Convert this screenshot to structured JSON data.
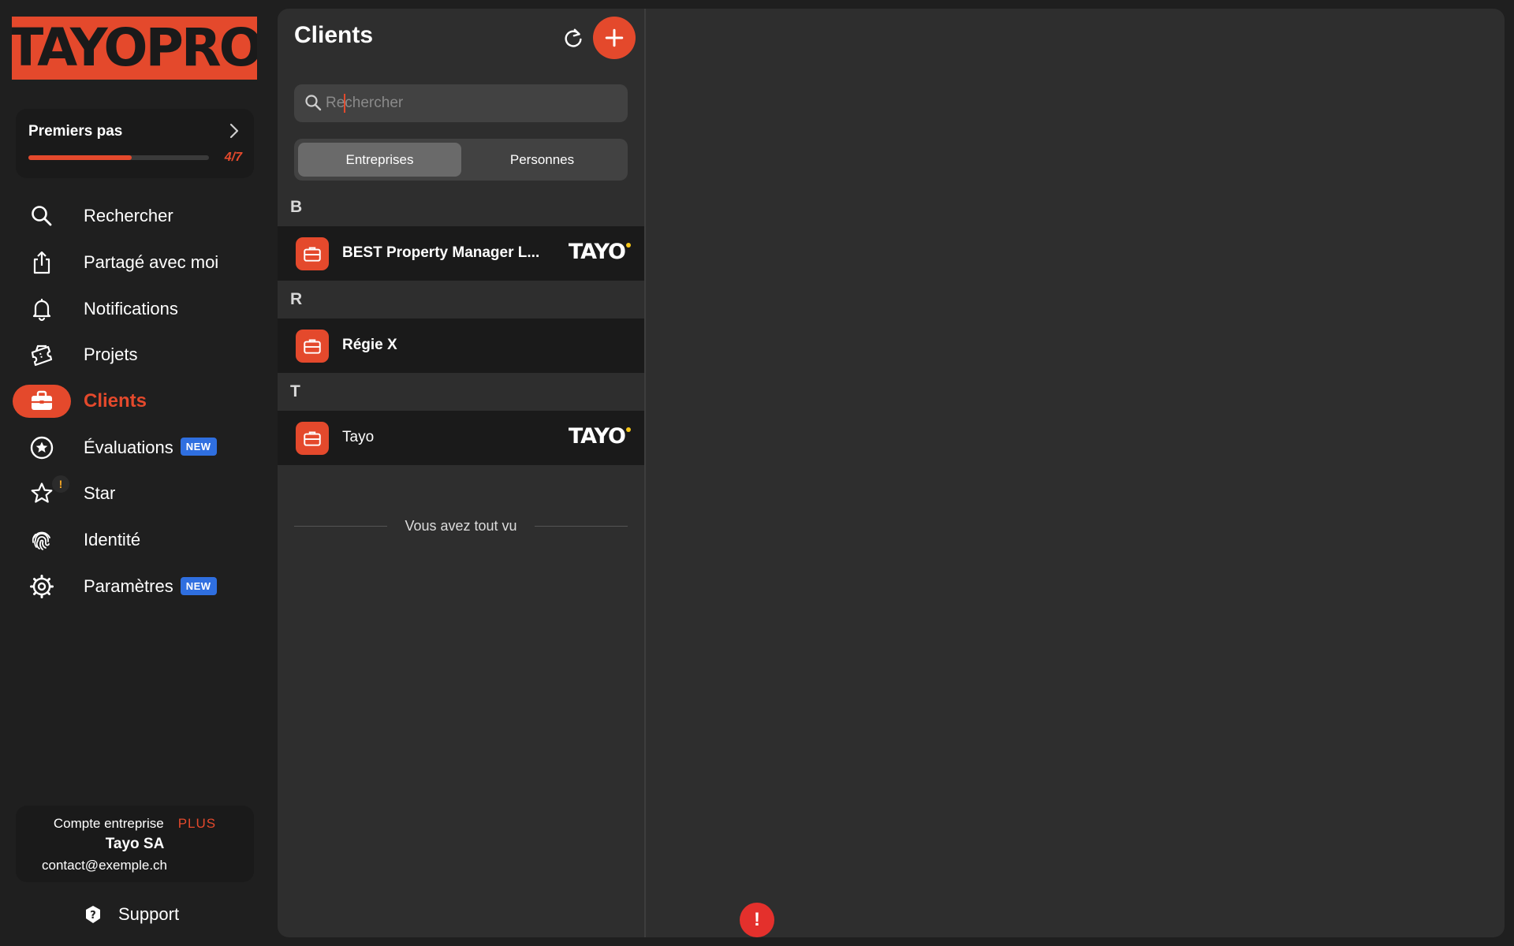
{
  "brand": {
    "logo_text": "TAYOPRO",
    "accent": "#e4492c"
  },
  "onboarding": {
    "title": "Premiers pas",
    "progress": 0.5714,
    "count": "4/7"
  },
  "nav": {
    "items": [
      {
        "label": "Rechercher",
        "icon": "search-icon"
      },
      {
        "label": "Partagé avec moi",
        "icon": "share-icon"
      },
      {
        "label": "Notifications",
        "icon": "bell-icon"
      },
      {
        "label": "Projets",
        "icon": "ticket-icon"
      },
      {
        "label": "Clients",
        "icon": "briefcase-icon",
        "active": true
      },
      {
        "label": "Évaluations",
        "icon": "star-circle-icon",
        "badge": "NEW"
      },
      {
        "label": "Star",
        "icon": "star-icon",
        "alert": "!"
      },
      {
        "label": "Identité",
        "icon": "fingerprint-icon"
      },
      {
        "label": "Paramètres",
        "icon": "settings-icon",
        "badge": "NEW"
      }
    ]
  },
  "account": {
    "type": "Compte entreprise",
    "plan": "PLUS",
    "name": "Tayo SA",
    "email": "contact@exemple.ch"
  },
  "support": {
    "label": "Support"
  },
  "clients": {
    "title": "Clients",
    "search_placeholder": "Rechercher",
    "segments": [
      "Entreprises",
      "Personnes"
    ],
    "selected_segment": "Entreprises",
    "groups": [
      {
        "letter": "B",
        "rows": [
          {
            "name": "BEST Property Manager L...",
            "tayo": true
          }
        ]
      },
      {
        "letter": "R",
        "rows": [
          {
            "name": "Régie X",
            "tayo": false
          }
        ]
      },
      {
        "letter": "T",
        "rows": [
          {
            "name": "Tayo",
            "tayo": true
          }
        ]
      }
    ],
    "end_note": "Vous avez tout vu",
    "tayo_mark": "TAYO"
  },
  "alert": {
    "label": "!"
  }
}
